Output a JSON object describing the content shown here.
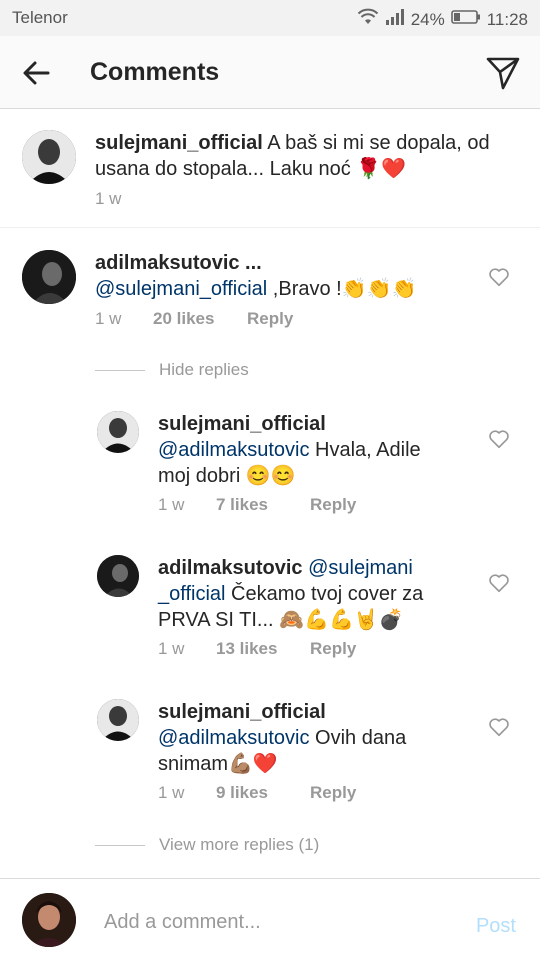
{
  "status_bar": {
    "carrier": "Telenor",
    "battery": "24%",
    "time": "11:28"
  },
  "header": {
    "title": "Comments"
  },
  "caption": {
    "username": "sulejmani_official",
    "text": "A baš si mi se dopala, od usana do stopala... Laku noć 🌹❤️",
    "time": "1 w"
  },
  "comments": [
    {
      "username": "adilmaksutovic ...",
      "mention": "@sulejmani_official",
      "text": " ,Bravo !👏👏👏",
      "time": "1 w",
      "likes": "20 likes",
      "reply": "Reply"
    }
  ],
  "hide_replies": "Hide replies",
  "replies": [
    {
      "username": "sulejmani_official",
      "mention": "@adilmaksutovic",
      "text_line1": " Hvala, Adile",
      "text_line2": "moj dobri 😊😊",
      "time": "1 w",
      "likes": "7 likes",
      "reply": "Reply"
    },
    {
      "username": "adilmaksutovic",
      "mention_part1": "@sulejmani",
      "mention_part2": "_official",
      "text_line2": " Čekamo tvoj cover za",
      "text_line3": "PRVA SI TI... 🙈💪💪🤘💣",
      "time": "1 w",
      "likes": "13 likes",
      "reply": "Reply"
    },
    {
      "username": "sulejmani_official",
      "mention": "@adilmaksutovic",
      "text_line1": " Ovih dana",
      "text_line2": "snimam💪🏽❤️",
      "time": "1 w",
      "likes": "9 likes",
      "reply": "Reply"
    }
  ],
  "view_more_replies": "View more replies (1)",
  "composer": {
    "placeholder": "Add a comment...",
    "post_label": "Post"
  }
}
